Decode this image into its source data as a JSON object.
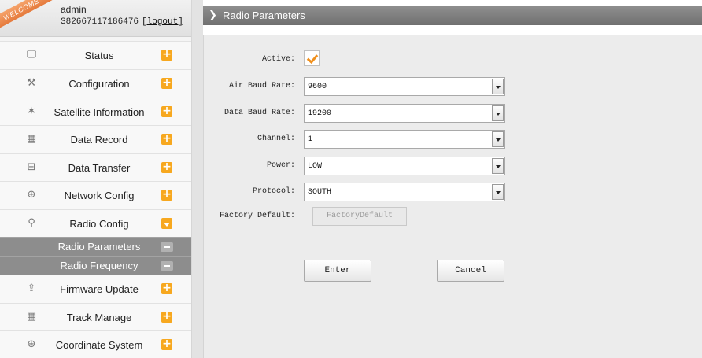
{
  "user": {
    "welcome": "WELCOME",
    "name": "admin",
    "id": "S82667117186476",
    "logout": "[logout]"
  },
  "menu": {
    "items": [
      {
        "label": "Status",
        "icon": "monitor-icon",
        "glyph": "🖵"
      },
      {
        "label": "Configuration",
        "icon": "tools-icon",
        "glyph": "⚒"
      },
      {
        "label": "Satellite Information",
        "icon": "satellite-icon",
        "glyph": "✶"
      },
      {
        "label": "Data Record",
        "icon": "calendar-icon",
        "glyph": "▦"
      },
      {
        "label": "Data Transfer",
        "icon": "network-icon",
        "glyph": "⊟"
      },
      {
        "label": "Network Config",
        "icon": "globe-icon",
        "glyph": "⊕"
      },
      {
        "label": "Radio Config",
        "icon": "antenna-icon",
        "glyph": "⚲"
      }
    ],
    "sub_items": [
      {
        "label": "Radio Parameters"
      },
      {
        "label": "Radio Frequency"
      }
    ],
    "items_after": [
      {
        "label": "Firmware Update",
        "icon": "upload-icon",
        "glyph": "⇪"
      },
      {
        "label": "Track Manage",
        "icon": "calendar-icon",
        "glyph": "▦"
      },
      {
        "label": "Coordinate System",
        "icon": "globe-icon",
        "glyph": "⊕"
      }
    ],
    "plus_symbol": "+"
  },
  "page": {
    "title": "Radio Parameters",
    "chevron": "❯"
  },
  "form": {
    "active_label": "Active:",
    "active_checked": true,
    "air_baud_label": "Air Baud Rate:",
    "air_baud_value": "9600",
    "data_baud_label": "Data Baud Rate:",
    "data_baud_value": "19200",
    "channel_label": "Channel:",
    "channel_value": "1",
    "power_label": "Power:",
    "power_value": "LOW",
    "protocol_label": "Protocol:",
    "protocol_value": "SOUTH",
    "factory_label": "Factory Default:",
    "factory_button": "FactoryDefault",
    "enter_button": "Enter",
    "cancel_button": "Cancel"
  },
  "colors": {
    "accent": "#f7a81f",
    "header_bar": "#7f7f7f",
    "content_bg": "#ececec",
    "submenu_bg": "#8d8d8d"
  }
}
